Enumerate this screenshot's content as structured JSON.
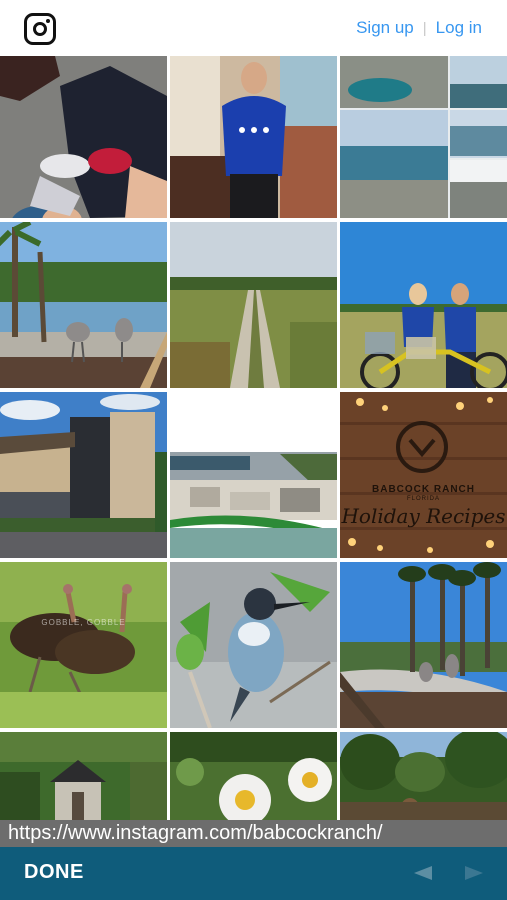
{
  "header": {
    "logo_icon": "instagram-glyph-icon",
    "signup_label": "Sign up",
    "login_label": "Log in",
    "accent_color": "#3897f0"
  },
  "grid": {
    "tiles": [
      {
        "subject": "Sneakers on pavement"
      },
      {
        "subject": "Man in blue t-shirt"
      },
      {
        "subject": "Aerial lake views"
      },
      {
        "subject": "Sandhill cranes by lake"
      },
      {
        "subject": "Dirt path through field"
      },
      {
        "subject": "Two women with bikes"
      },
      {
        "subject": "Modern building"
      },
      {
        "subject": "Aerial construction site"
      },
      {
        "subject": "Holiday recipes sign",
        "brand_text": "BABCOCK RANCH",
        "brand_sub": "FLORIDA",
        "script_text": "Holiday Recipes"
      },
      {
        "subject": "Wild turkeys",
        "watermark": "GOBBLE, GOBBLE"
      },
      {
        "subject": "Kingfisher bird"
      },
      {
        "subject": "Palm trees and cranes"
      },
      {
        "subject": "Chapel building"
      },
      {
        "subject": "Daisies"
      },
      {
        "subject": "Trees and shrubs"
      }
    ]
  },
  "browser": {
    "url": "https://www.instagram.com/babcockranch/",
    "done_label": "DONE",
    "back_icon": "back-arrow-icon",
    "forward_icon": "forward-arrow-icon",
    "bar_color": "#0f5c7b"
  }
}
